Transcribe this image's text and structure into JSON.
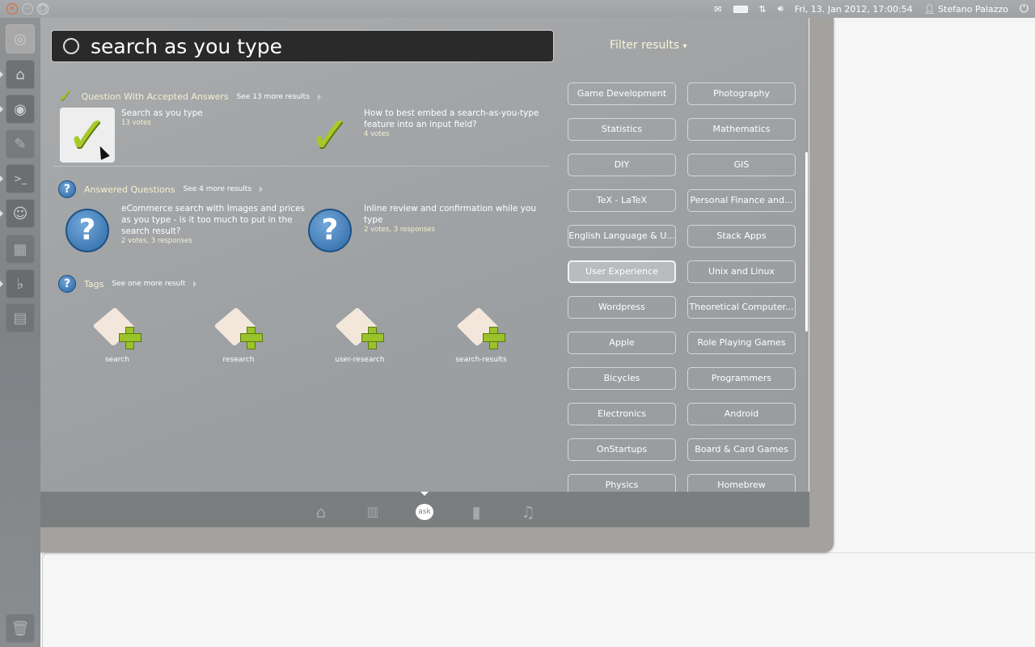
{
  "panel": {
    "clock": "Fri, 13. Jan 2012, 17:00:54",
    "user": "Stefano Palazzo",
    "icons": [
      "mail-icon",
      "battery-icon",
      "network-icon",
      "volume-icon",
      "user-icon",
      "power-icon"
    ]
  },
  "launcher": {
    "items": [
      "ubuntu-dash",
      "home-folder",
      "chromium",
      "text-editor",
      "terminal",
      "pidgin",
      "calculator",
      "banshee",
      "workspace-switcher",
      "trash"
    ]
  },
  "search": {
    "value": "search as you type"
  },
  "filter": {
    "label": "Filter results",
    "arrow": "▾",
    "buttons": [
      "Game Development",
      "Photography",
      "Statistics",
      "Mathematics",
      "DIY",
      "GIS",
      "TeX - LaTeX",
      "Personal Finance and...",
      "English Language & U...",
      "Stack Apps",
      "User Experience",
      "Unix and Linux",
      "Wordpress",
      "Theoretical Computer...",
      "Apple",
      "Role Playing Games",
      "Bicycles",
      "Programmers",
      "Electronics",
      "Android",
      "OnStartups",
      "Board & Card Games",
      "Physics",
      "Homebrew"
    ],
    "active": "User Experience"
  },
  "categories": [
    {
      "title": "Question With Accepted Answers",
      "more": "See 13 more results",
      "results": [
        {
          "title": "Search as you type",
          "meta": "13 votes"
        },
        {
          "title": "How to best embed a search-as-you-type feature into an input field?",
          "meta": "4 votes"
        }
      ]
    },
    {
      "title": "Answered Questions",
      "more": "See 4 more results",
      "results": [
        {
          "title": "eCommerce search with Images and prices as you type - is it too much to put in the search result?",
          "meta": "2 votes, 3 responses"
        },
        {
          "title": "Inline review and confirmation while you type",
          "meta": "2 votes, 3 responses"
        }
      ]
    },
    {
      "title": "Tags",
      "more": "See one more result",
      "results": [
        {
          "title": "search"
        },
        {
          "title": "research"
        },
        {
          "title": "user-research"
        },
        {
          "title": "search-results"
        }
      ]
    }
  ],
  "lenses": {
    "items": [
      "home",
      "applications",
      "ask",
      "files",
      "music"
    ],
    "active": "ask",
    "ask_label": "ask"
  },
  "colors": {
    "accent_green": "#9bc524",
    "question_blue": "#2a66a3",
    "dash_bg": "#9ea1a3"
  }
}
